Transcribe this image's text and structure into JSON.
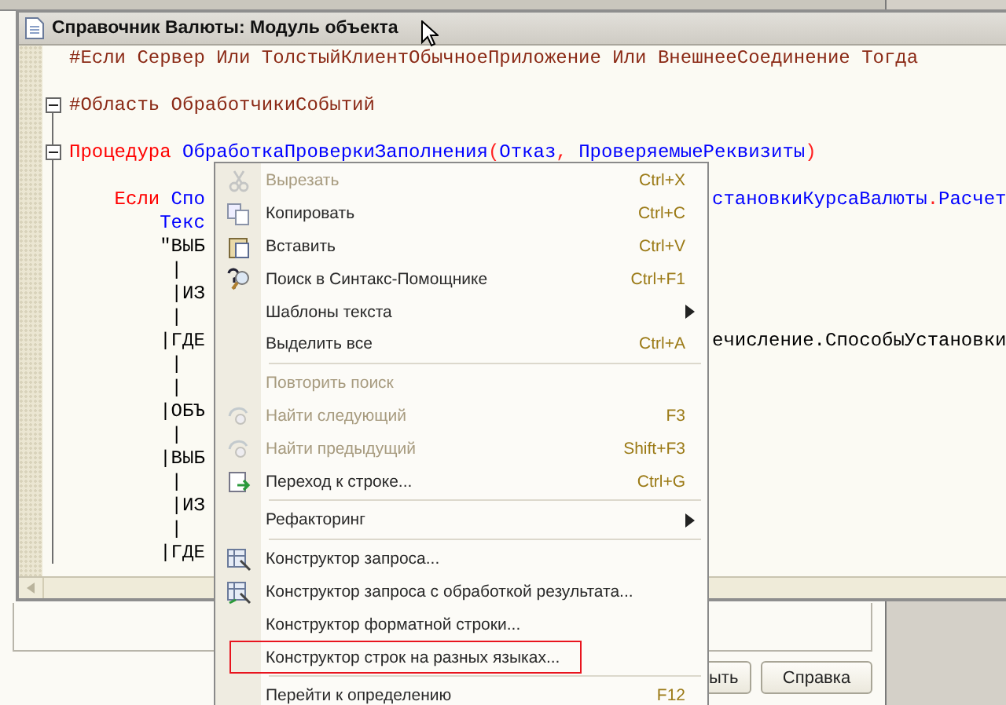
{
  "code_window": {
    "title": "Справочник Валюты: Модуль объекта",
    "lines": [
      {
        "kind": "code",
        "parts": [
          [
            {
              "kind": "preproc",
              "text": "#Если Сервер Или ТолстыйКлиентОбычноеПриложение Или ВнешнееСоединение Тогда"
            }
          ]
        ]
      },
      {
        "kind": "blank"
      },
      {
        "kind": "fold",
        "expanded": true,
        "parts": [
          [
            {
              "kind": "preproc",
              "text": "#Область ОбработчикиСобытий"
            }
          ]
        ]
      },
      {
        "kind": "blank"
      },
      {
        "kind": "fold",
        "expanded": true,
        "parts": [
          [
            {
              "kind": "keyword",
              "text": "Процедура"
            },
            {
              "kind": "ident",
              "text": " ОбработкаПроверкиЗаполнения"
            },
            {
              "kind": "op",
              "text": "("
            },
            {
              "kind": "ident",
              "text": "Отказ"
            },
            {
              "kind": "op",
              "text": ","
            },
            {
              "kind": "ident",
              "text": " ПроверяемыеРеквизиты"
            },
            {
              "kind": "op",
              "text": ")"
            }
          ]
        ]
      },
      {
        "kind": "blank"
      },
      {
        "kind": "code",
        "parts": [
          [
            {
              "kind": "keyword",
              "text": "    Если"
            },
            {
              "kind": "ident",
              "text": " Спо"
            }
          ],
          [
            {
              "kind": "ident",
              "text": "становкиКурсаВалюты"
            },
            {
              "kind": "op",
              "text": "."
            },
            {
              "kind": "ident",
              "text": "Расчет"
            }
          ]
        ]
      },
      {
        "kind": "code",
        "parts": [
          [
            {
              "kind": "ident",
              "text": "        Текс"
            }
          ]
        ]
      },
      {
        "kind": "code",
        "parts": [
          [
            {
              "kind": "text",
              "text": "        \"ВЫБ"
            }
          ]
        ]
      },
      {
        "kind": "code",
        "parts": [
          [
            {
              "kind": "text",
              "text": "         |"
            }
          ]
        ]
      },
      {
        "kind": "code",
        "parts": [
          [
            {
              "kind": "text",
              "text": "         |ИЗ"
            }
          ]
        ]
      },
      {
        "kind": "code",
        "parts": [
          [
            {
              "kind": "text",
              "text": "         |"
            }
          ]
        ]
      },
      {
        "kind": "code",
        "parts": [
          [
            {
              "kind": "text",
              "text": "        |ГДЕ"
            }
          ],
          [
            {
              "kind": "text",
              "text": "ечисление.СпособыУстановки"
            }
          ]
        ]
      },
      {
        "kind": "code",
        "parts": [
          [
            {
              "kind": "text",
              "text": "         |"
            }
          ]
        ]
      },
      {
        "kind": "code",
        "parts": [
          [
            {
              "kind": "text",
              "text": "         |"
            }
          ]
        ]
      },
      {
        "kind": "code",
        "parts": [
          [
            {
              "kind": "text",
              "text": "        |ОБЪ"
            }
          ]
        ]
      },
      {
        "kind": "code",
        "parts": [
          [
            {
              "kind": "text",
              "text": "         |"
            }
          ]
        ]
      },
      {
        "kind": "code",
        "parts": [
          [
            {
              "kind": "text",
              "text": "        |ВЫБ"
            }
          ]
        ]
      },
      {
        "kind": "code",
        "parts": [
          [
            {
              "kind": "text",
              "text": "         |"
            }
          ]
        ]
      },
      {
        "kind": "code",
        "parts": [
          [
            {
              "kind": "text",
              "text": "         |ИЗ"
            }
          ]
        ]
      },
      {
        "kind": "code",
        "parts": [
          [
            {
              "kind": "text",
              "text": "         |"
            }
          ]
        ]
      },
      {
        "kind": "code",
        "parts": [
          [
            {
              "kind": "text",
              "text": "        |ГДЕ"
            }
          ]
        ]
      }
    ]
  },
  "context_menu": [
    {
      "kind": "item",
      "label": "Вырезать",
      "shortcut": "Ctrl+X",
      "disabled": true,
      "outlined": false
    },
    {
      "kind": "item",
      "label": "Копировать",
      "shortcut": "Ctrl+C",
      "disabled": false,
      "outlined": false
    },
    {
      "kind": "item",
      "label": "Вставить",
      "shortcut": "Ctrl+V",
      "disabled": false,
      "outlined": false
    },
    {
      "kind": "item",
      "label": "Поиск в Синтакс-Помощнике",
      "shortcut": "Ctrl+F1",
      "disabled": false,
      "outlined": false
    },
    {
      "kind": "submenu",
      "label": "Шаблоны текста",
      "disabled": false,
      "outlined": false
    },
    {
      "kind": "item",
      "label": "Выделить все",
      "shortcut": "Ctrl+A",
      "disabled": false,
      "outlined": false
    },
    {
      "kind": "separator"
    },
    {
      "kind": "item",
      "label": "Повторить поиск",
      "disabled": true,
      "outlined": false
    },
    {
      "kind": "item",
      "label": "Найти следующий",
      "shortcut": "F3",
      "disabled": true,
      "outlined": false
    },
    {
      "kind": "item",
      "label": "Найти предыдущий",
      "shortcut": "Shift+F3",
      "disabled": true,
      "outlined": false
    },
    {
      "kind": "item",
      "label": "Переход к строке...",
      "shortcut": "Ctrl+G",
      "disabled": false,
      "outlined": false
    },
    {
      "kind": "separator"
    },
    {
      "kind": "submenu",
      "label": "Рефакторинг",
      "disabled": false,
      "outlined": false
    },
    {
      "kind": "separator"
    },
    {
      "kind": "item",
      "label": "Конструктор запроса...",
      "disabled": false,
      "outlined": false
    },
    {
      "kind": "item",
      "label": "Конструктор запроса с обработкой результата...",
      "disabled": false,
      "outlined": false
    },
    {
      "kind": "item",
      "label": "Конструктор форматной строки...",
      "disabled": false,
      "outlined": false
    },
    {
      "kind": "item",
      "label": "Конструктор строк на разных языках...",
      "disabled": false,
      "outlined": true
    },
    {
      "kind": "separator"
    },
    {
      "kind": "item",
      "label": "Перейти к определению",
      "shortcut": "F12",
      "disabled": false,
      "outlined": false
    }
  ],
  "form_buttons": [
    "ыть",
    "Справка"
  ]
}
